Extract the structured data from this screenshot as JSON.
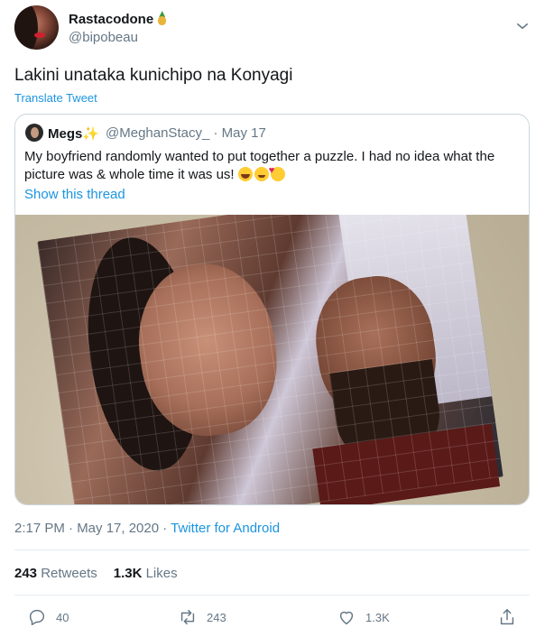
{
  "author": {
    "name": "Rastacodone",
    "handle": "@bipobeau"
  },
  "tweet": {
    "text": "Lakini unataka kunichipo na Konyagi",
    "translate_label": "Translate Tweet"
  },
  "quoted": {
    "name": "Megs",
    "handle": "@MeghanStacy_ · May 17",
    "text": "My boyfriend randomly wanted to put together a puzzle. I had no idea what the picture was & whole time it was us! ",
    "show_thread": "Show this thread"
  },
  "meta": {
    "time": "2:17 PM · May 17, 2020 · ",
    "source": "Twitter for Android"
  },
  "stats": {
    "retweets_count": "243",
    "retweets_label": "Retweets",
    "likes_count": "1.3K",
    "likes_label": "Likes"
  },
  "actions": {
    "replies": "40",
    "retweets": "243",
    "likes": "1.3K"
  },
  "colors": {
    "accent": "#1b95e0",
    "secondary_text": "#657786",
    "border": "#ccd6dd"
  }
}
